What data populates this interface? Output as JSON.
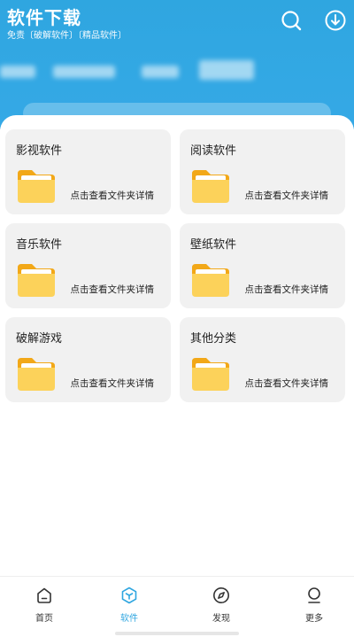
{
  "header": {
    "title": "软件下载",
    "subtitle": "免责〔破解软件〕〔精品软件〕",
    "search_icon": "search-icon",
    "download_icon": "download-icon",
    "background_color": "#35a9e6"
  },
  "categories": [
    {
      "title": "影视软件",
      "desc": "点击查看文件夹详情"
    },
    {
      "title": "阅读软件",
      "desc": "点击查看文件夹详情"
    },
    {
      "title": "音乐软件",
      "desc": "点击查看文件夹详情"
    },
    {
      "title": "壁纸软件",
      "desc": "点击查看文件夹详情"
    },
    {
      "title": "破解游戏",
      "desc": "点击查看文件夹详情"
    },
    {
      "title": "其他分类",
      "desc": "点击查看文件夹详情"
    }
  ],
  "bottom_nav": {
    "active_index": 1,
    "active_color": "#2fa6e0",
    "items": [
      {
        "label": "首页",
        "icon": "home-icon"
      },
      {
        "label": "软件",
        "icon": "software-icon"
      },
      {
        "label": "发现",
        "icon": "compass-icon"
      },
      {
        "label": "更多",
        "icon": "more-icon"
      }
    ]
  }
}
